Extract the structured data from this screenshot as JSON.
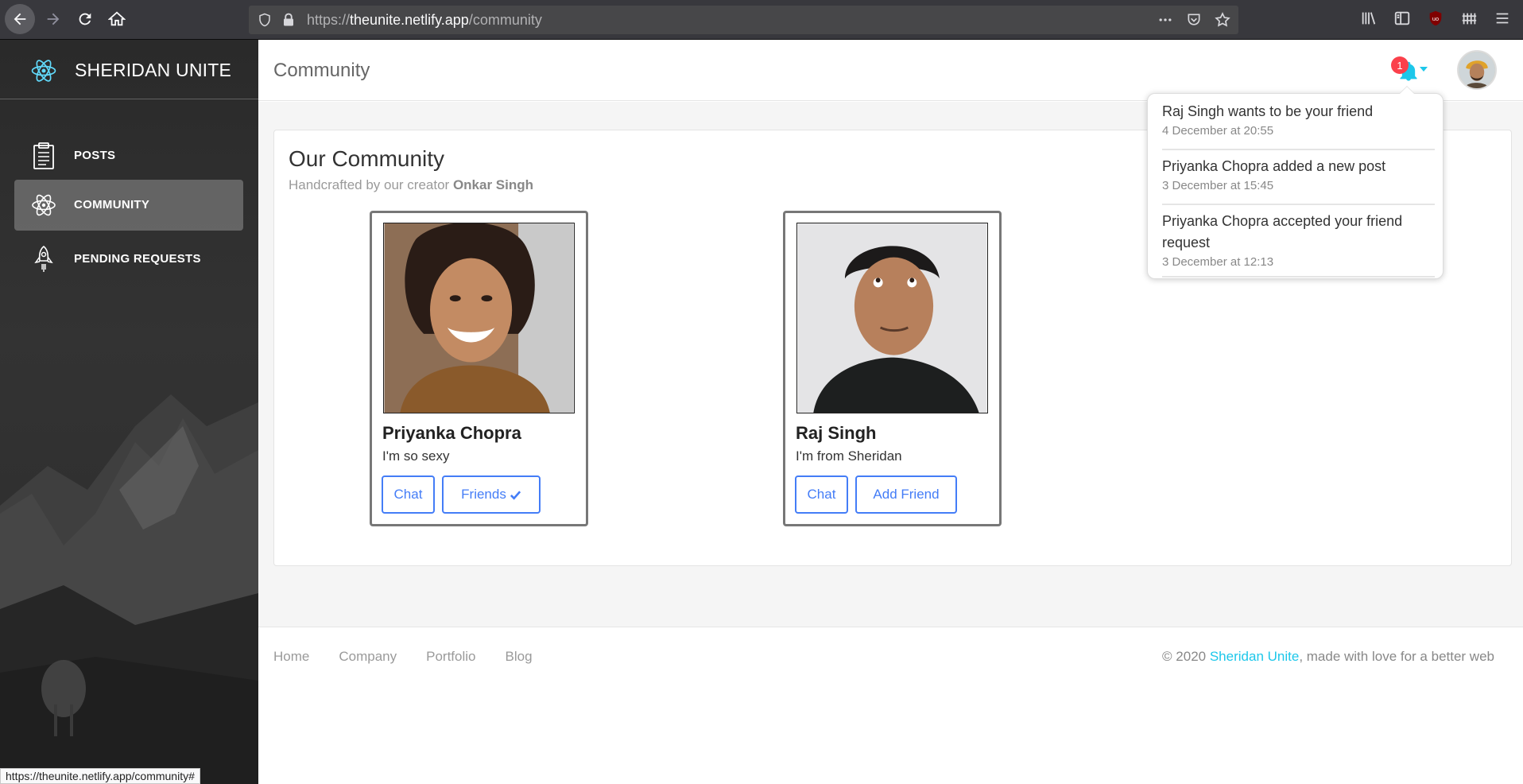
{
  "browser": {
    "url_scheme": "https://",
    "url_host": "theunite.netlify.app",
    "url_path": "/community",
    "status_url": "https://theunite.netlify.app/community#"
  },
  "sidebar": {
    "brand": "SHERIDAN UNITE",
    "items": [
      {
        "label": "POSTS",
        "icon": "clipboard-icon",
        "active": false
      },
      {
        "label": "COMMUNITY",
        "icon": "atom-icon",
        "active": true
      },
      {
        "label": "PENDING REQUESTS",
        "icon": "rocket-icon",
        "active": false
      }
    ]
  },
  "header": {
    "title": "Community",
    "notification_count": "1"
  },
  "notifications": [
    {
      "text": "Raj Singh wants to be your friend",
      "time": "4 December at 20:55"
    },
    {
      "text": "Priyanka Chopra added a new post",
      "time": "3 December at 15:45"
    },
    {
      "text": "Priyanka Chopra accepted your friend request",
      "time": "3 December at 12:13"
    }
  ],
  "community": {
    "title": "Our Community",
    "subtitle_prefix": "Handcrafted by our creator",
    "creator": "Onkar Singh",
    "people": [
      {
        "name": "Priyanka Chopra",
        "bio": "I'm so sexy",
        "chat_label": "Chat",
        "friend_label": "Friends",
        "friend_icon": "check-icon"
      },
      {
        "name": "Raj Singh",
        "bio": "I'm from Sheridan",
        "chat_label": "Chat",
        "friend_label": "Add Friend"
      }
    ]
  },
  "footer": {
    "links": [
      "Home",
      "Company",
      "Portfolio",
      "Blog"
    ],
    "copyright_prefix": "© 2020",
    "copyright_brand": "Sheridan Unite",
    "copyright_suffix": ", made with love for a better web"
  },
  "colors": {
    "accent": "#1dc7ea",
    "button": "#447df7",
    "badge": "#fb404b"
  }
}
